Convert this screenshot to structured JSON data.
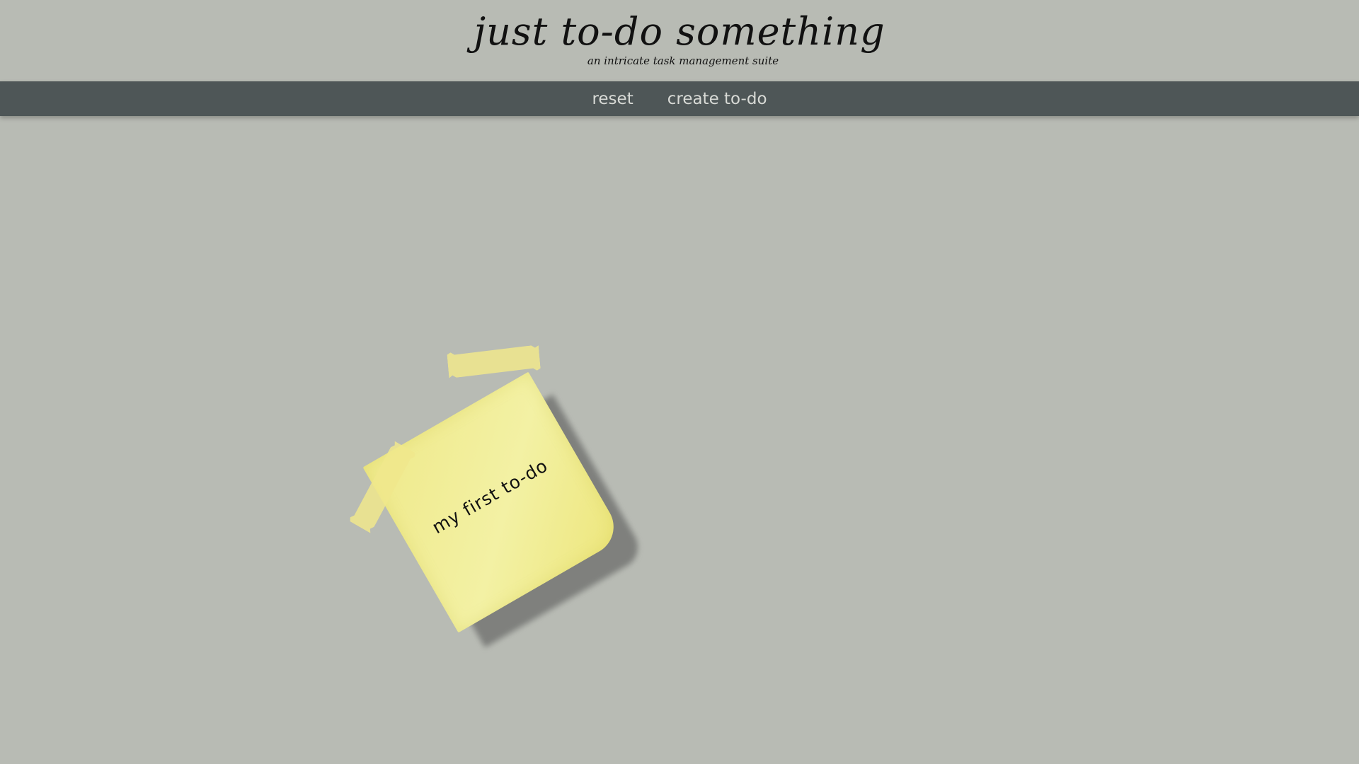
{
  "header": {
    "title": "just to-do something",
    "subtitle": "an intricate task management suite"
  },
  "nav": {
    "reset_label": "reset",
    "create_label": "create to-do"
  },
  "notes": [
    {
      "text": "my first to-do"
    }
  ],
  "colors": {
    "background": "#b8bbb4",
    "navbar": "#4e5657",
    "note": "#f0eb8c"
  }
}
